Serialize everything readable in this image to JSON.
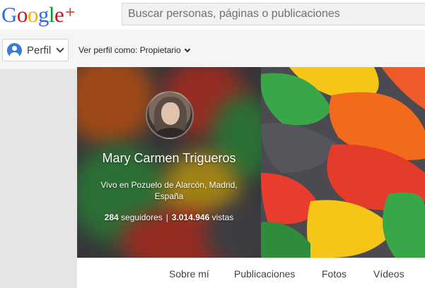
{
  "header": {
    "logo_text": "Google",
    "logo_plus": "+",
    "logo_colors": [
      "#3369e8",
      "#d50f25",
      "#eeb211",
      "#3369e8",
      "#009925",
      "#d50f25"
    ],
    "search_placeholder": "Buscar personas, páginas o publicaciones"
  },
  "subbar": {
    "perfil_label": "Perfil",
    "view_as_label": "Ver perfil como: Propietario"
  },
  "profile": {
    "name": "Mary Carmen Trigueros",
    "location_line1": "Vivo en Pozuelo de Alarcón, Madrid,",
    "location_line2": "España",
    "followers_count": "284",
    "followers_label": "seguidores",
    "separator": "|",
    "views_count": "3.014.946",
    "views_label": "vistas"
  },
  "tabs": [
    {
      "label": "Sobre mí"
    },
    {
      "label": "Publicaciones"
    },
    {
      "label": "Fotos"
    },
    {
      "label": "Vídeos"
    }
  ],
  "colors": {
    "brand_red": "#dd4b39",
    "cover_orange": "#f26a1b",
    "cover_green": "#3aa64a",
    "cover_yellow": "#f5c518",
    "cover_red": "#e53b2a",
    "cover_gray": "#55565c"
  },
  "icons": {
    "perfil": "person-circle-icon",
    "dropdown": "chevron-down-icon"
  }
}
